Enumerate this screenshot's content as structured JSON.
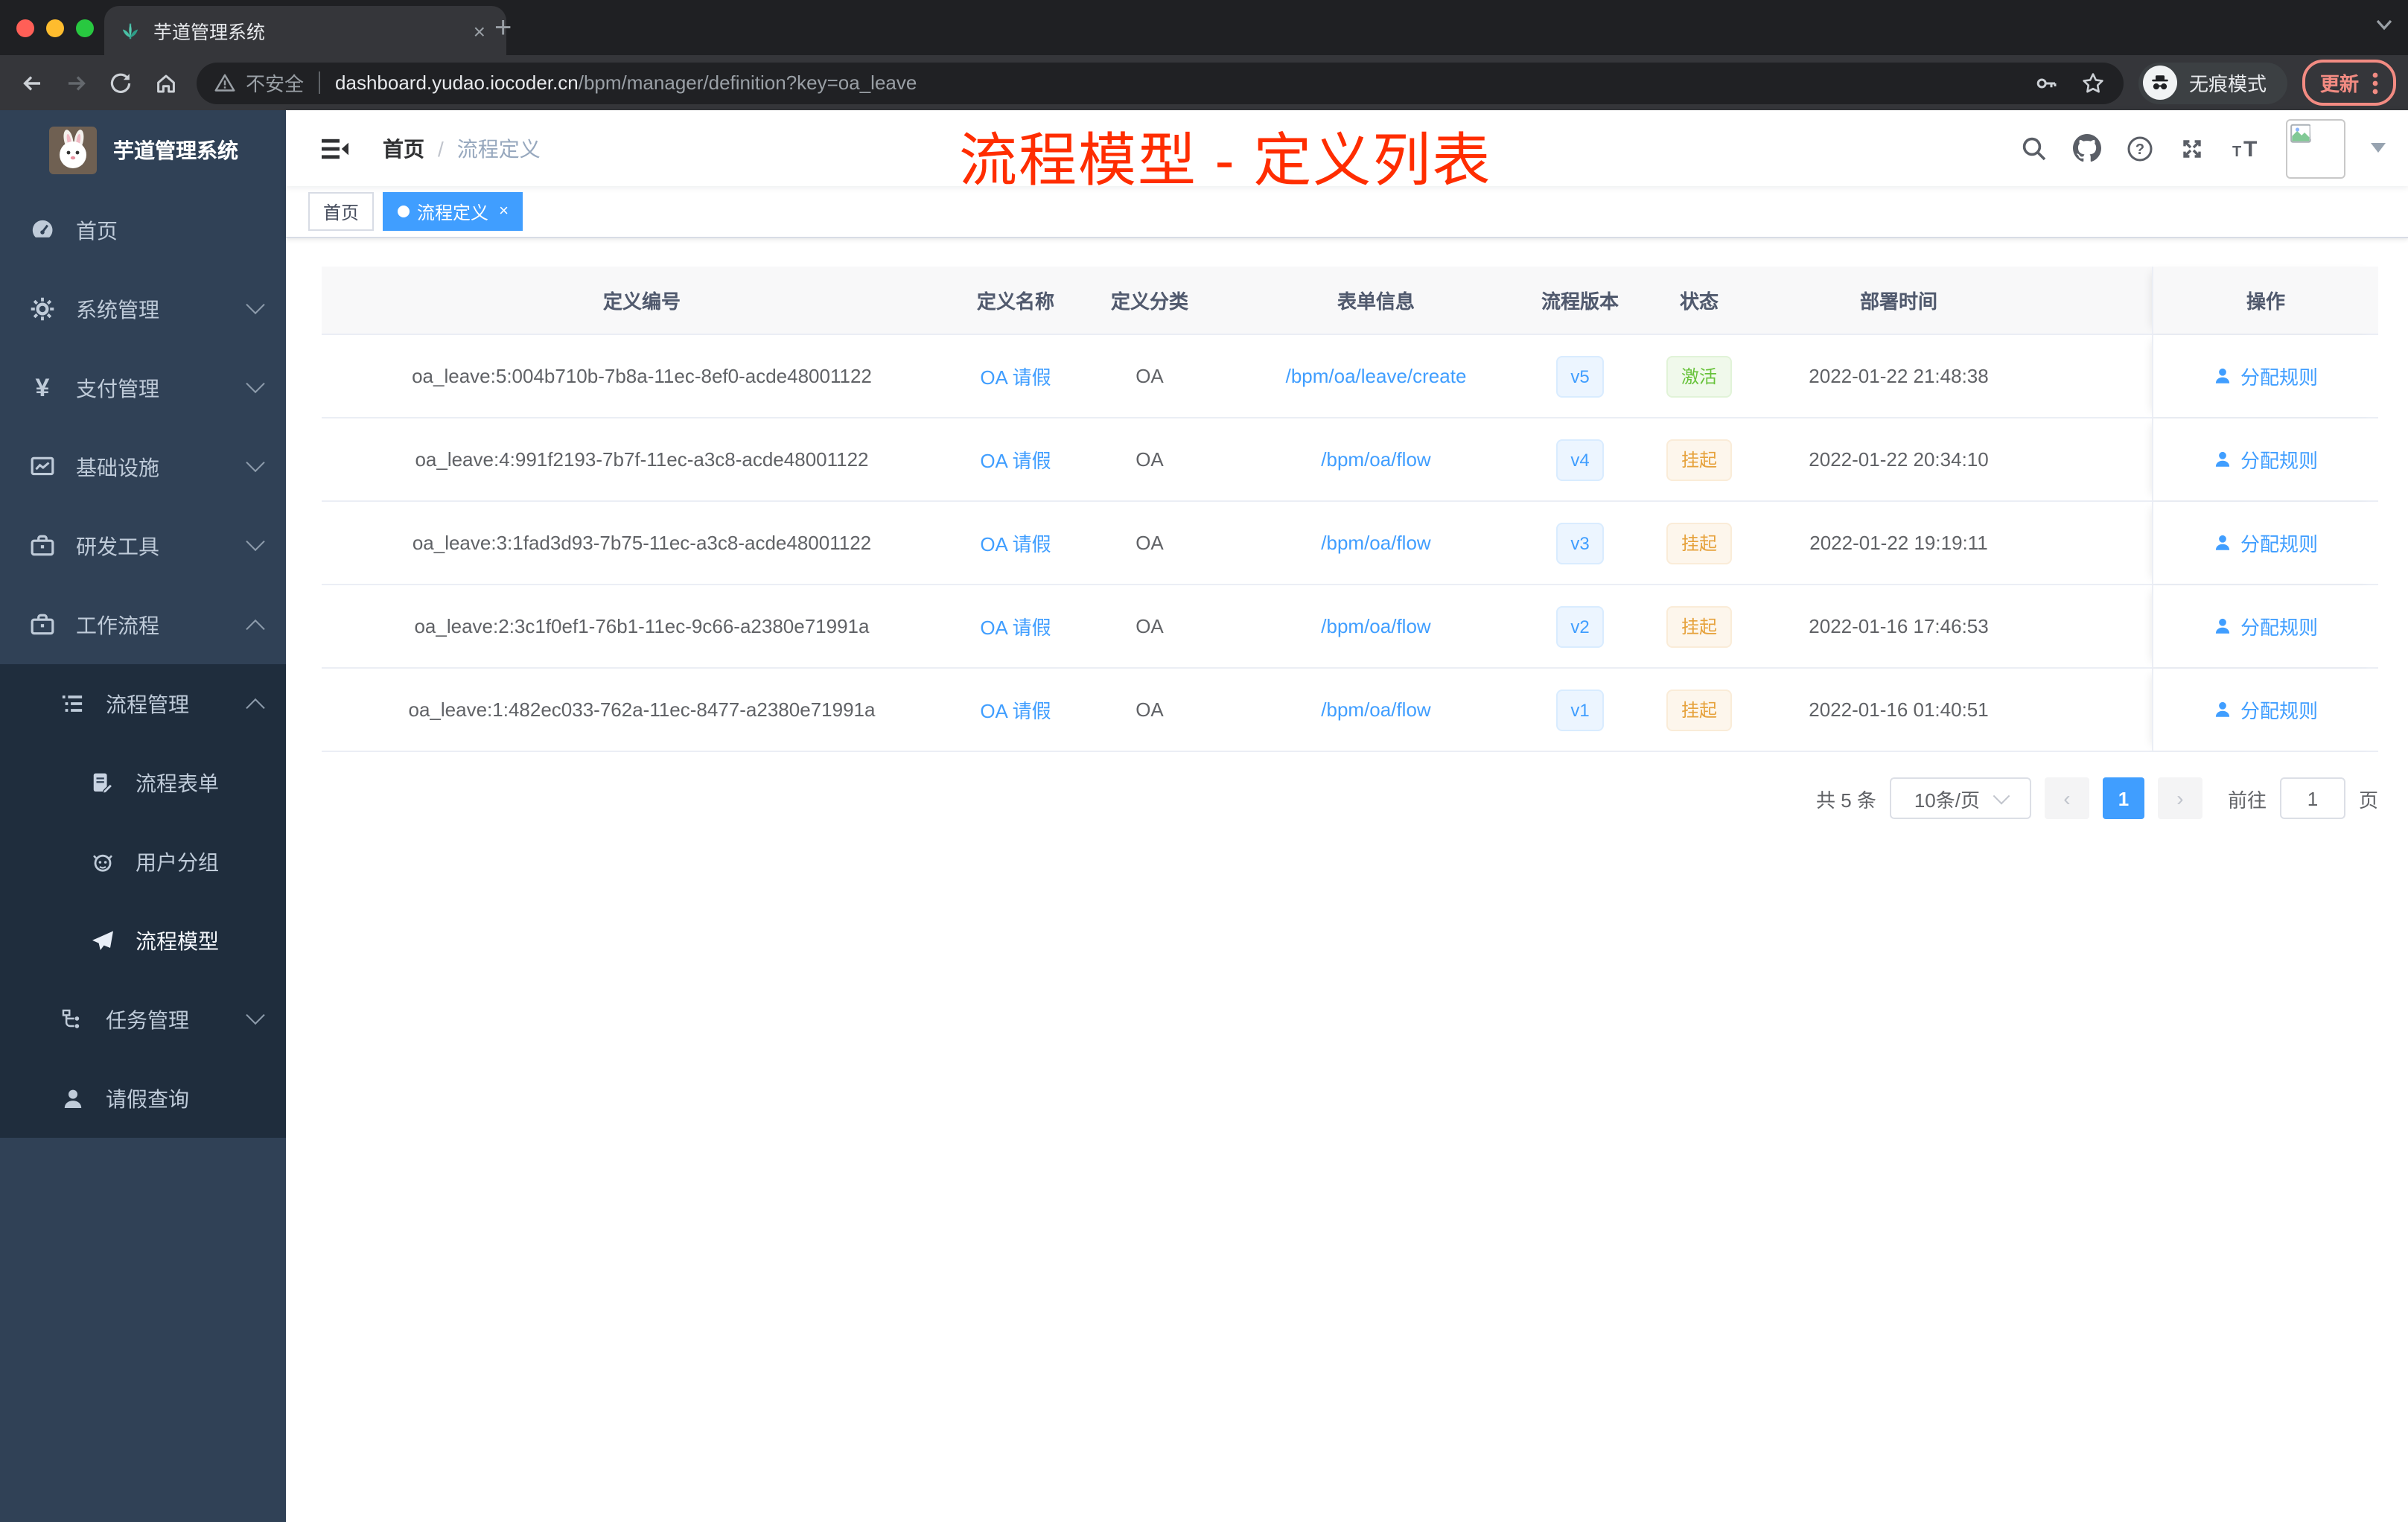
{
  "browser": {
    "tab_title": "芋道管理系统",
    "tab_close": "×",
    "new_tab": "+",
    "security_label": "不安全",
    "url_host": "dashboard.yudao.iocoder.cn",
    "url_path": "/bpm/manager/definition?key=oa_leave",
    "incognito_label": "无痕模式",
    "update_label": "更新"
  },
  "annotation": {
    "title": "流程模型 - 定义列表",
    "color": "#ff2d00"
  },
  "sidebar": {
    "logo_title": "芋道管理系统",
    "items": [
      "首页",
      "系统管理",
      "支付管理",
      "基础设施",
      "研发工具",
      "工作流程"
    ],
    "workflow_children": [
      "流程管理",
      "流程表单",
      "用户分组",
      "流程模型",
      "任务管理",
      "请假查询"
    ]
  },
  "navbar": {
    "breadcrumb_home": "首页",
    "breadcrumb_separator": "/",
    "breadcrumb_current": "流程定义"
  },
  "tags": {
    "home": "首页",
    "active": "流程定义",
    "close": "×"
  },
  "table": {
    "columns": [
      "定义编号",
      "定义名称",
      "定义分类",
      "表单信息",
      "流程版本",
      "状态",
      "部署时间",
      "操作"
    ],
    "rows": [
      {
        "id": "oa_leave:5:004b710b-7b8a-11ec-8ef0-acde48001122",
        "name": "OA 请假",
        "category": "OA",
        "form": "/bpm/oa/leave/create",
        "version": "v5",
        "status": "激活",
        "deployed_at": "2022-01-22 21:48:38",
        "action": "分配规则"
      },
      {
        "id": "oa_leave:4:991f2193-7b7f-11ec-a3c8-acde48001122",
        "name": "OA 请假",
        "category": "OA",
        "form": "/bpm/oa/flow",
        "version": "v4",
        "status": "挂起",
        "deployed_at": "2022-01-22 20:34:10",
        "action": "分配规则"
      },
      {
        "id": "oa_leave:3:1fad3d93-7b75-11ec-a3c8-acde48001122",
        "name": "OA 请假",
        "category": "OA",
        "form": "/bpm/oa/flow",
        "version": "v3",
        "status": "挂起",
        "deployed_at": "2022-01-22 19:19:11",
        "action": "分配规则"
      },
      {
        "id": "oa_leave:2:3c1f0ef1-76b1-11ec-9c66-a2380e71991a",
        "name": "OA 请假",
        "category": "OA",
        "form": "/bpm/oa/flow",
        "version": "v2",
        "status": "挂起",
        "deployed_at": "2022-01-16 17:46:53",
        "action": "分配规则"
      },
      {
        "id": "oa_leave:1:482ec033-762a-11ec-8477-a2380e71991a",
        "name": "OA 请假",
        "category": "OA",
        "form": "/bpm/oa/flow",
        "version": "v1",
        "status": "挂起",
        "deployed_at": "2022-01-16 01:40:51",
        "action": "分配规则"
      }
    ]
  },
  "pagination": {
    "total_label": "共 5 条",
    "page_size": "10条/页",
    "prev": "‹",
    "current_page": "1",
    "next": "›",
    "goto_label": "前往",
    "goto_value": "1",
    "page_unit": "页"
  },
  "colors": {
    "accent": "#409eff",
    "success": "#67c23a",
    "warning": "#e6a23c",
    "annotation_red": "#ff2d00",
    "sidebar_bg": "#304156",
    "submenu_bg": "#1f2d3d"
  }
}
